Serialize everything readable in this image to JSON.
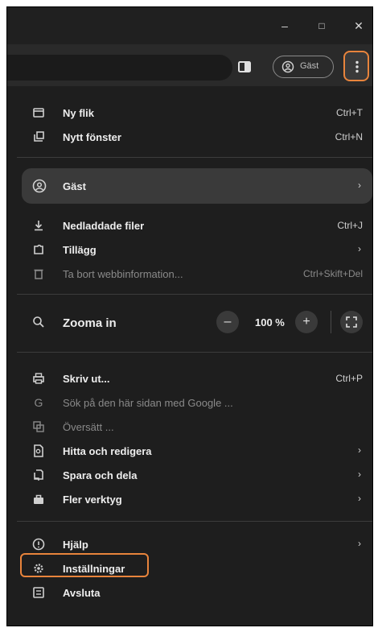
{
  "window": {
    "minimize": "–",
    "maximize": "□",
    "close": "✕"
  },
  "toolbar": {
    "profile_label": "Gäst"
  },
  "menu": {
    "new_tab": {
      "label": "Ny flik",
      "shortcut": "Ctrl+T"
    },
    "new_window": {
      "label": "Nytt fönster",
      "shortcut": "Ctrl+N"
    },
    "guest": {
      "label": "Gäst"
    },
    "downloads": {
      "label": "Nedladdade filer",
      "shortcut": "Ctrl+J"
    },
    "extensions": {
      "label": "Tillägg"
    },
    "clear_data": {
      "label": "Ta bort webbinformation...",
      "shortcut": "Ctrl+Skift+Del"
    },
    "zoom": {
      "label": "Zooma in",
      "minus": "–",
      "value": "100 %",
      "plus": "+"
    },
    "print": {
      "label": "Skriv ut...",
      "shortcut": "Ctrl+P"
    },
    "search_google": {
      "label": "Sök på den här sidan med Google ..."
    },
    "translate": {
      "label": "Översätt ..."
    },
    "find_edit": {
      "label": "Hitta och redigera"
    },
    "save_share": {
      "label": "Spara och dela"
    },
    "more_tools": {
      "label": "Fler verktyg"
    },
    "help": {
      "label": "Hjälp"
    },
    "settings": {
      "label": "Inställningar"
    },
    "exit": {
      "label": "Avsluta"
    }
  },
  "colors": {
    "background": "#1e1e1e",
    "accent_highlight": "#e8843c",
    "guest_row": "#3a3a3a"
  }
}
